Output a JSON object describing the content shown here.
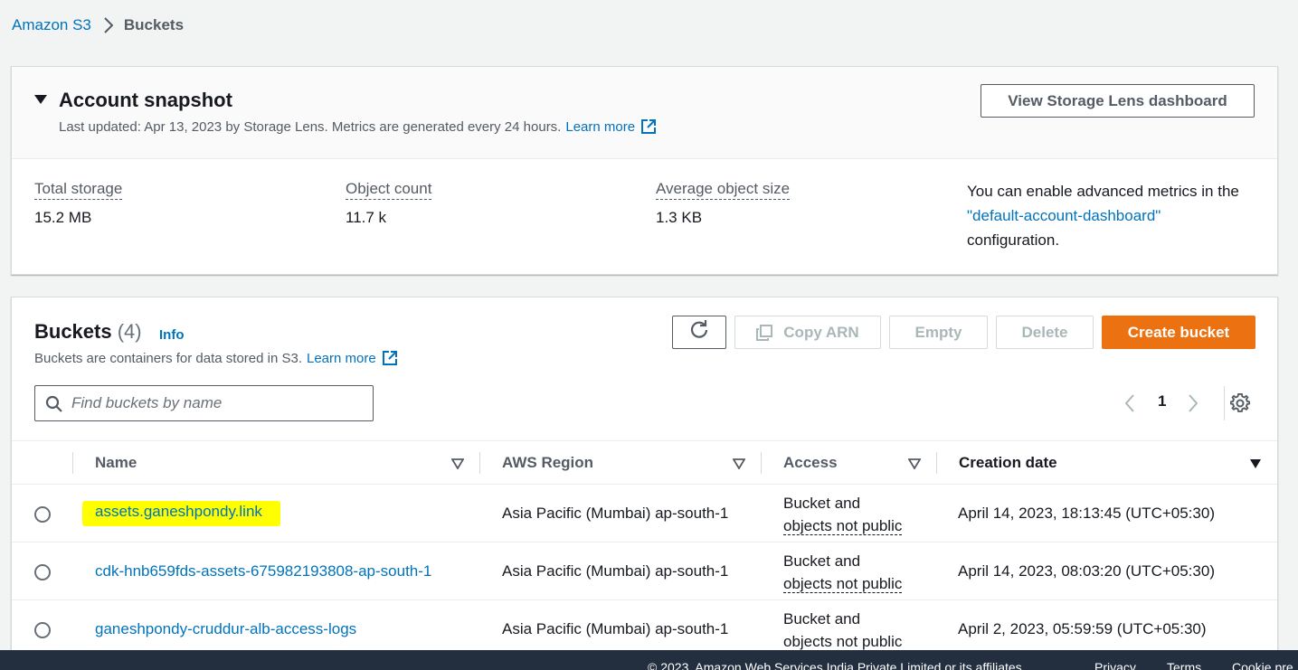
{
  "breadcrumb": {
    "root": "Amazon S3",
    "current": "Buckets"
  },
  "snapshot": {
    "title": "Account snapshot",
    "subtitle": "Last updated: Apr 13, 2023 by Storage Lens. Metrics are generated every 24 hours.",
    "learn_more": "Learn more",
    "dashboard_button": "View Storage Lens dashboard",
    "metrics": [
      {
        "label": "Total storage",
        "value": "15.2 MB"
      },
      {
        "label": "Object count",
        "value": "11.7 k"
      },
      {
        "label": "Average object size",
        "value": "1.3 KB"
      }
    ],
    "advanced": {
      "text1": "You can enable advanced metrics in the",
      "link": "\"default-account-dashboard\"",
      "text2": "configuration."
    }
  },
  "buckets": {
    "title": "Buckets",
    "count": "(4)",
    "info": "Info",
    "subtitle": "Buckets are containers for data stored in S3.",
    "learn_more": "Learn more",
    "actions": {
      "copy_arn": "Copy ARN",
      "empty": "Empty",
      "delete": "Delete",
      "create": "Create bucket"
    },
    "search_placeholder": "Find buckets by name",
    "page": "1",
    "columns": {
      "name": "Name",
      "region": "AWS Region",
      "access": "Access",
      "created": "Creation date"
    },
    "rows": [
      {
        "name": "assets.ganeshpondy.link",
        "region": "Asia Pacific (Mumbai) ap-south-1",
        "access_l1": "Bucket and",
        "access_l2": "objects not public",
        "created": "April 14, 2023, 18:13:45 (UTC+05:30)"
      },
      {
        "name": "cdk-hnb659fds-assets-675982193808-ap-south-1",
        "region": "Asia Pacific (Mumbai) ap-south-1",
        "access_l1": "Bucket and",
        "access_l2": "objects not public",
        "created": "April 14, 2023, 08:03:20 (UTC+05:30)"
      },
      {
        "name": "ganeshpondy-cruddur-alb-access-logs",
        "region": "Asia Pacific (Mumbai) ap-south-1",
        "access_l1": "Bucket and",
        "access_l2": "objects not public",
        "created": "April 2, 2023, 05:59:59 (UTC+05:30)"
      }
    ]
  },
  "footer": {
    "copyright": "© 2023, Amazon Web Services India Private Limited or its affiliates.",
    "privacy": "Privacy",
    "terms": "Terms",
    "cookie": "Cookie pre"
  }
}
